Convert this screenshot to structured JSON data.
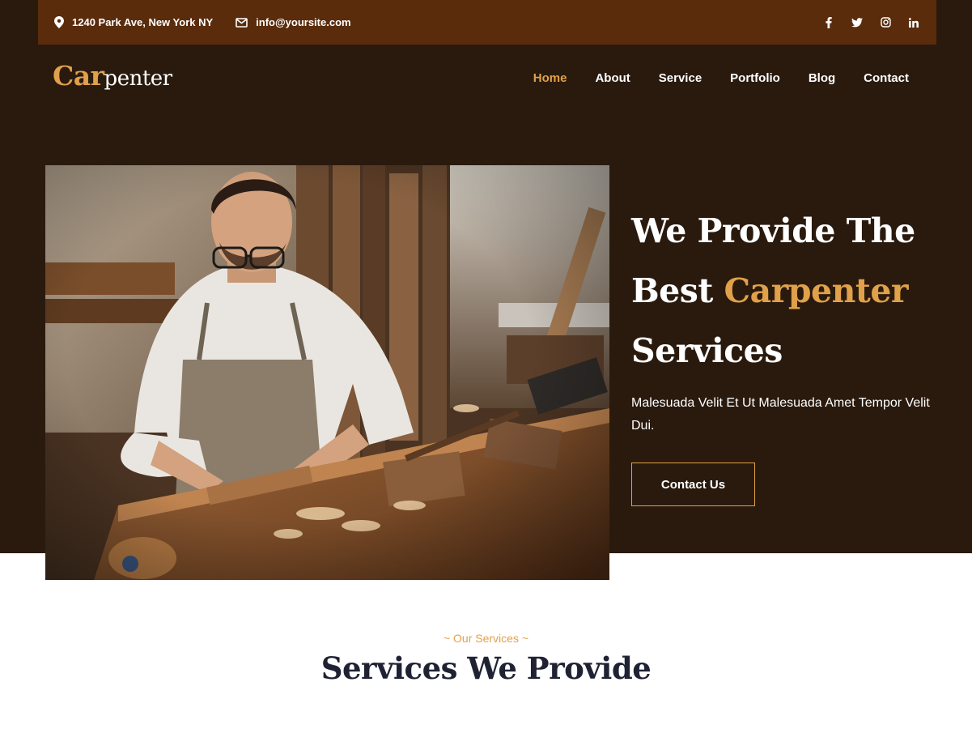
{
  "topbar": {
    "address": "1240 Park Ave, New York NY",
    "email": "info@yoursite.com",
    "social": [
      "facebook-icon",
      "twitter-icon",
      "instagram-icon",
      "linkedin-icon"
    ]
  },
  "logo": {
    "part1": "Car",
    "part2": "penter"
  },
  "nav": {
    "items": [
      "Home",
      "About",
      "Service",
      "Portfolio",
      "Blog",
      "Contact"
    ],
    "active": "Home"
  },
  "hero": {
    "title_line1": "We Provide The",
    "title_best": "Best",
    "title_highlight": "Carpenter",
    "title_line3": "Services",
    "description": "Malesuada Velit Et Ut Malesuada Amet Tempor Velit Dui.",
    "cta_label": "Contact Us",
    "image": "carpenter-working-at-bench"
  },
  "services": {
    "kicker": "~ Our Services ~",
    "title": "Services We Provide"
  },
  "colors": {
    "accent": "#e0a14a",
    "topbar": "#5a2c0c",
    "dark": "#2a1a0e",
    "heading_dark": "#1f2233"
  }
}
